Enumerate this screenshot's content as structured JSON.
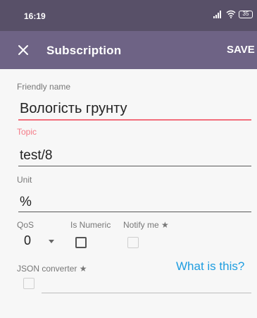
{
  "status_bar": {
    "time": "16:19",
    "battery": "35"
  },
  "app_bar": {
    "title": "Subscription",
    "save_label": "SAVE"
  },
  "form": {
    "friendly_name": {
      "label": "Friendly name",
      "value": "Вологість грунту"
    },
    "topic": {
      "label": "Topic",
      "value": "test/8"
    },
    "unit": {
      "label": "Unit",
      "value": "%"
    },
    "qos": {
      "label": "QoS",
      "value": "0"
    },
    "is_numeric": {
      "label": "Is Numeric",
      "checked": false
    },
    "notify_me": {
      "label": "Notify me ★",
      "checked": false,
      "enabled": false
    },
    "json_converter": {
      "label": "JSON converter ★",
      "checked": false,
      "enabled": false,
      "link": "What is this?"
    }
  },
  "colors": {
    "status_bar": "#585068",
    "app_bar": "#6e6385",
    "accent": "#f26f7c",
    "link": "#1e9de0"
  }
}
